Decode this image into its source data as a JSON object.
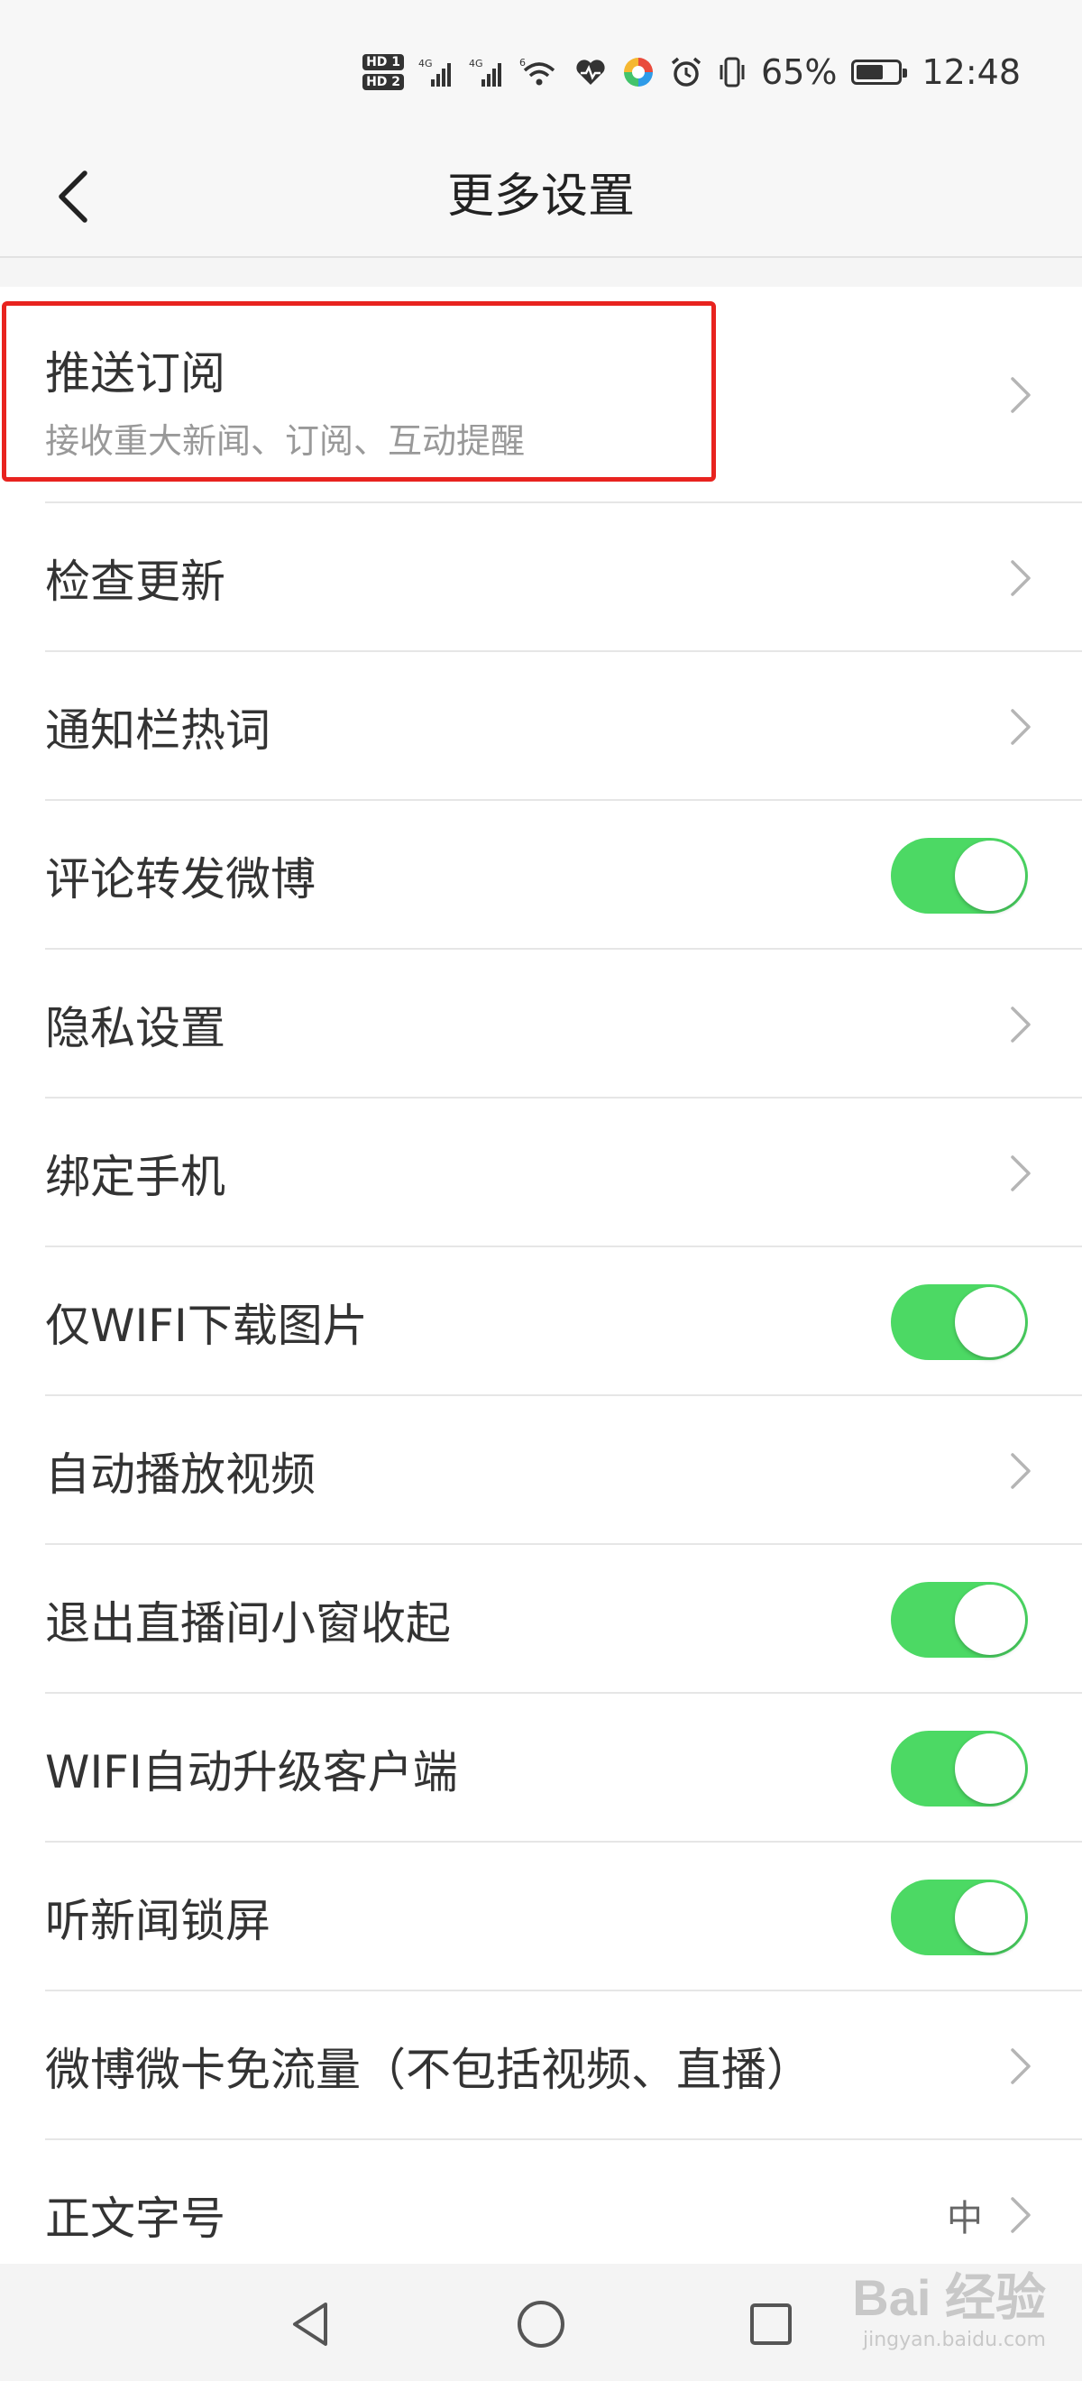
{
  "status_bar": {
    "hd1": "HD 1",
    "hd2": "HD 2",
    "net1": "4G",
    "net2": "4G",
    "wifi_tag": "6",
    "battery_percent_text": "65%",
    "battery_level": 0.65,
    "time": "12:48",
    "icons": [
      "signal-icon",
      "wifi-icon",
      "health-icon",
      "app-icon",
      "alarm-icon",
      "vibrate-icon",
      "battery-icon"
    ]
  },
  "header": {
    "title": "更多设置",
    "back_icon": "chevron-left-icon"
  },
  "settings": [
    {
      "label": "推送订阅",
      "subtitle": "接收重大新闻、订阅、互动提醒",
      "control": "chevron"
    },
    {
      "label": "检查更新",
      "control": "chevron"
    },
    {
      "label": "通知栏热词",
      "control": "chevron"
    },
    {
      "label": "评论转发微博",
      "control": "toggle",
      "on": true
    },
    {
      "label": "隐私设置",
      "control": "chevron"
    },
    {
      "label": "绑定手机",
      "control": "chevron"
    },
    {
      "label": "仅WIFI下载图片",
      "control": "toggle",
      "on": true
    },
    {
      "label": "自动播放视频",
      "control": "chevron"
    },
    {
      "label": "退出直播间小窗收起",
      "control": "toggle",
      "on": true
    },
    {
      "label": "WIFI自动升级客户端",
      "control": "toggle",
      "on": true
    },
    {
      "label": "听新闻锁屏",
      "control": "toggle",
      "on": true
    },
    {
      "label": "微博微卡免流量（不包括视频、直播）",
      "control": "chevron"
    },
    {
      "label": "正文字号",
      "value": "中",
      "control": "chevron"
    }
  ],
  "colors": {
    "toggle_on": "#4cd964",
    "highlight": "#e8231f",
    "background": "#f5f5f5"
  },
  "nav_bar": {
    "icons": [
      "back-triangle-icon",
      "home-circle-icon",
      "recents-square-icon"
    ]
  },
  "watermark": {
    "logo": "Bai 经验",
    "url": "jingyan.baidu.com"
  }
}
